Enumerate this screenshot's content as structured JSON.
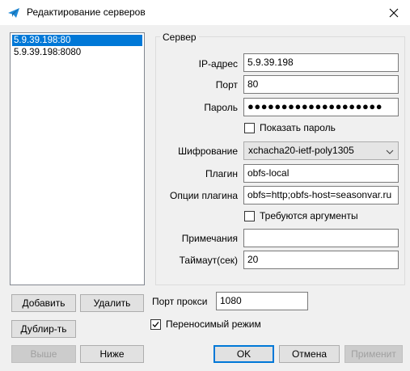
{
  "window": {
    "title": "Редактирование серверов",
    "close_label": "Close"
  },
  "server_list": {
    "items": [
      {
        "label": "5.9.39.198:80",
        "selected": true
      },
      {
        "label": "5.9.39.198:8080",
        "selected": false
      }
    ]
  },
  "server": {
    "group_title": "Сервер",
    "ip_label": "IP-адрес",
    "ip_value": "5.9.39.198",
    "port_label": "Порт",
    "port_value": "80",
    "password_label": "Пароль",
    "password_value": "●●●●●●●●●●●●●●●●●●●●",
    "show_password_label": "Показать пароль",
    "show_password_checked": false,
    "encryption_label": "Шифрование",
    "encryption_value": "xchacha20-ietf-poly1305",
    "plugin_label": "Плагин",
    "plugin_value": "obfs-local",
    "plugin_options_label": "Опции плагина",
    "plugin_options_value": "obfs=http;obfs-host=seasonvar.ru",
    "requires_args_label": "Требуются аргументы",
    "requires_args_checked": false,
    "remarks_label": "Примечания",
    "remarks_value": "",
    "timeout_label": "Таймаут(сек)",
    "timeout_value": "20"
  },
  "list_buttons": {
    "add": "Добавить",
    "delete": "Удалить",
    "duplicate": "Дублир-ть",
    "up": "Выше",
    "down": "Ниже"
  },
  "proxy": {
    "port_label": "Порт прокси",
    "port_value": "1080",
    "portable_label": "Переносимый режим",
    "portable_checked": true
  },
  "dialog_buttons": {
    "ok": "OK",
    "cancel": "Отмена",
    "apply": "Применит"
  },
  "colors": {
    "accent": "#0078d7",
    "icon": "#1f8ad8"
  }
}
